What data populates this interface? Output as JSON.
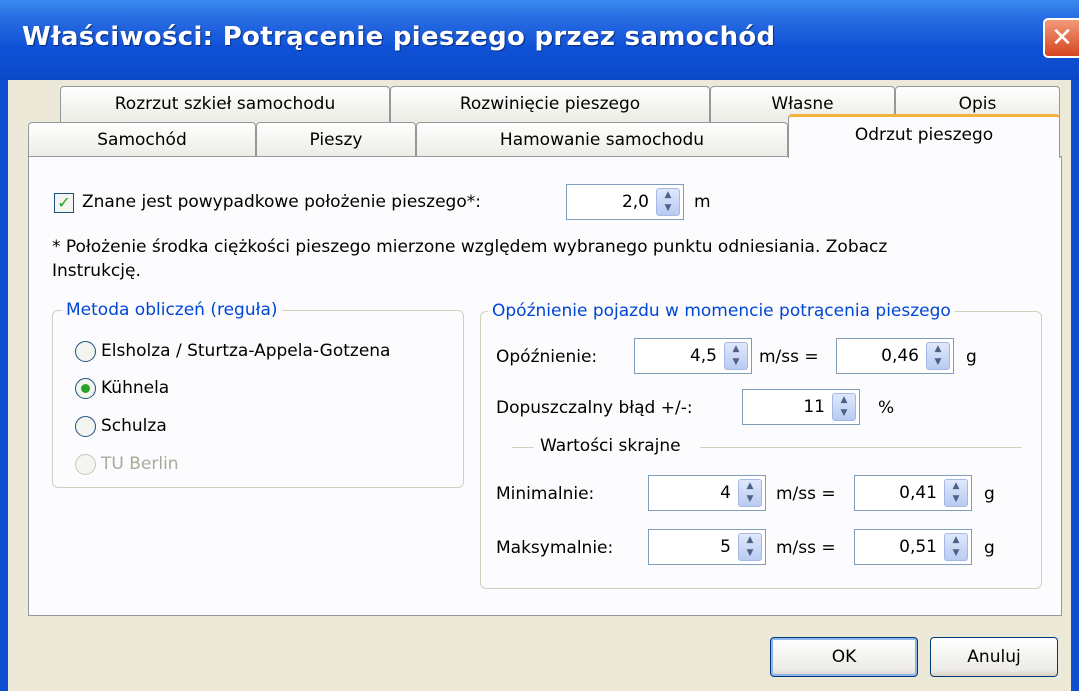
{
  "window": {
    "title": "Właściwości: Potrącenie pieszego przez samochód",
    "close_glyph": "✕"
  },
  "tabs_back": [
    "Rozrzut szkieł samochodu",
    "Rozwinięcie pieszego",
    "Własne",
    "Opis"
  ],
  "tabs_front": [
    "Samochód",
    "Pieszy",
    "Hamowanie samochodu",
    "Odrzut pieszego"
  ],
  "active_tab": "Odrzut pieszego",
  "known_position": {
    "checked": true,
    "check_glyph": "✓",
    "label": "Znane jest powypadkowe położenie pieszego*:",
    "value": "2,0",
    "unit": "m"
  },
  "note": {
    "line1": "* Położenie środka ciężkości pieszego mierzone względem wybranego punktu odniesiania. Zobacz",
    "line2": "Instrukcję."
  },
  "method_group": {
    "legend": "Metoda obliczeń (reguła)",
    "options": [
      {
        "label": "Elsholza / Sturtza-Appela-Gotzena",
        "checked": false,
        "enabled": true
      },
      {
        "label": "Kühnela",
        "checked": true,
        "enabled": true
      },
      {
        "label": "Schulza",
        "checked": false,
        "enabled": true
      },
      {
        "label": "TU Berlin",
        "checked": false,
        "enabled": false
      }
    ]
  },
  "deceleration_group": {
    "legend": "Opóźnienie pojazdu w momencie potrącenia pieszego",
    "deceleration": {
      "label": "Opóźnienie:",
      "value": "4,5",
      "unit1": "m/ss =",
      "g_value": "0,46",
      "unit2": "g"
    },
    "tolerance": {
      "label": "Dopuszczalny błąd +/-:",
      "value": "11",
      "unit": "%"
    },
    "extremes_title": "Wartości skrajne",
    "minimum": {
      "label": "Minimalnie:",
      "value": "4",
      "unit1": "m/ss =",
      "g_value": "0,41",
      "unit2": "g"
    },
    "maximum": {
      "label": "Maksymalnie:",
      "value": "5",
      "unit1": "m/ss =",
      "g_value": "0,51",
      "unit2": "g"
    }
  },
  "spin_glyphs": {
    "up": "▲",
    "down": "▼"
  },
  "buttons": {
    "ok": "OK",
    "cancel": "Anuluj"
  }
}
